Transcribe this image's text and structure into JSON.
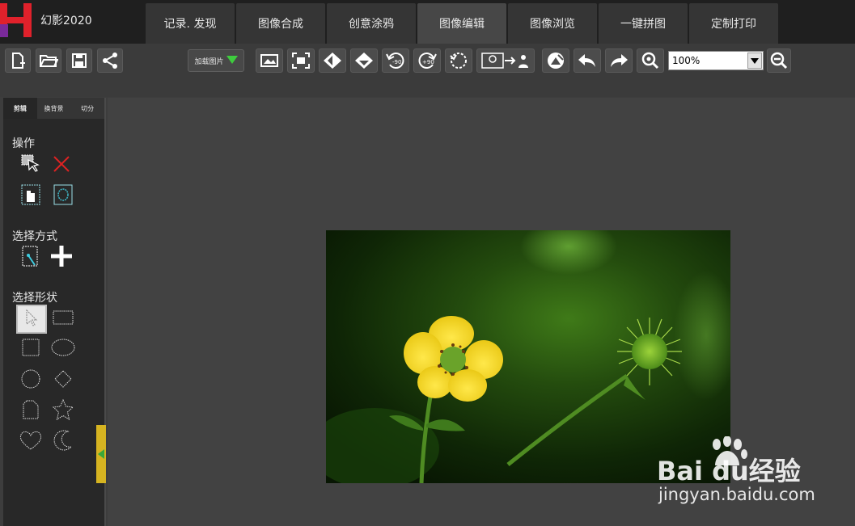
{
  "app": {
    "title": "幻影2020"
  },
  "tabs": [
    {
      "label": "记录. 发现",
      "active": false
    },
    {
      "label": "图像合成",
      "active": false
    },
    {
      "label": "创意涂鸦",
      "active": false
    },
    {
      "label": "图像编辑",
      "active": true
    },
    {
      "label": "图像浏览",
      "active": false
    },
    {
      "label": "一键拼图",
      "active": false
    },
    {
      "label": "定制打印",
      "active": false
    }
  ],
  "toolbar": {
    "load_label": "加载图片",
    "zoom_value": "100%",
    "icons": [
      "new-file-icon",
      "open-folder-icon",
      "save-icon",
      "share-icon",
      "fit-image-icon",
      "actual-size-icon",
      "flip-horizontal-icon",
      "flip-vertical-icon",
      "rotate-left-90-icon",
      "rotate-right-90-icon",
      "free-rotate-icon",
      "resize-icon",
      "clear-icon",
      "undo-icon",
      "redo-icon",
      "zoom-in-icon",
      "zoom-out-icon"
    ]
  },
  "left_panel": {
    "tabs": [
      {
        "label": "剪辑",
        "active": true
      },
      {
        "label": "换背景",
        "active": false
      },
      {
        "label": "切分",
        "active": false
      }
    ],
    "sections": {
      "operation": "操作",
      "select_mode": "选择方式",
      "select_shape": "选择形状"
    }
  },
  "watermark": {
    "brand": "Bai du经验",
    "url": "jingyan.baidu.com"
  },
  "colors": {
    "accent": "#d6b421",
    "header_bg": "#1f1f1f",
    "logo_red": "#e0212b"
  }
}
